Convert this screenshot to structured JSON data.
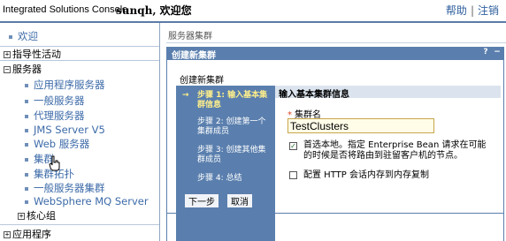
{
  "banner": {
    "product": "Integrated Solutions Console",
    "welcome": "sunqh, 欢迎您",
    "help": "帮助",
    "separator": "|",
    "logout": "注销"
  },
  "nav": {
    "welcome": "欢迎",
    "guided_activities": "指导性活动",
    "servers": "服务器",
    "server_items": [
      "应用程序服务器",
      "一般服务器",
      "代理服务器",
      "JMS Server V5",
      "Web 服务器",
      "集群",
      "集群拓扑",
      "一般服务器集群",
      "WebSphere MQ Server"
    ],
    "core_groups": "核心组",
    "applications": "应用程序",
    "expand_symbol": "+",
    "collapse_symbol": "−"
  },
  "main": {
    "breadcrumb": "服务器集群",
    "panel_title": "创建新集群",
    "help_symbol": "?",
    "minimize_symbol": "−",
    "task_title": "创建新集群",
    "steps": [
      {
        "arrow": "→",
        "label": "步骤 1: 输入基本集群信息"
      },
      {
        "label": "步骤 2: 创建第一个集群成员"
      },
      {
        "label": "步骤 3: 创建其他集群成员"
      },
      {
        "label": "步骤 4: 总结"
      }
    ],
    "content_heading": "输入基本集群信息",
    "cluster_name_label": "集群名",
    "required_marker": "*",
    "cluster_name_value": "TestClusters",
    "prefer_local": {
      "checked": true,
      "text": "首选本地。指定 Enterprise Bean 请求在可能的时候是否将路由到驻留客户机的节点。"
    },
    "replication": {
      "checked": false,
      "text": "配置 HTTP 会话内存到内存复制"
    },
    "next_button": "下一步",
    "cancel_button": "取消"
  },
  "colors": {
    "accent": "#5a7fae",
    "link": "#3c6aa8",
    "active_step": "#ffef8a"
  }
}
